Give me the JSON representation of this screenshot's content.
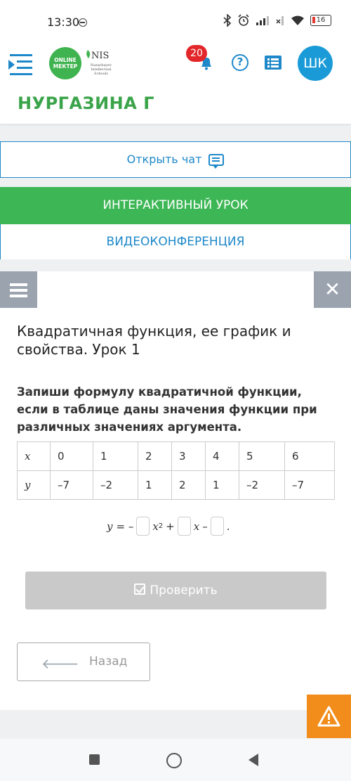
{
  "status_bar": {
    "time": "13:30",
    "battery": "16",
    "icons": [
      "bluetooth-icon",
      "alarm-icon",
      "signal-icon",
      "wifi-icon",
      "battery-icon"
    ]
  },
  "header": {
    "logo_onlinemektep": "ONLINE МЕКТЕР",
    "logo_nis": "NIS",
    "logo_nis_sub": "Nazarbayev Intellectual Schools",
    "notifications_count": "20",
    "avatar_initials": "ШК"
  },
  "user": {
    "name": "НУРГАЗИНА Г"
  },
  "buttons": {
    "open_chat": "Открыть чат",
    "interactive_lesson": "ИНТЕРАКТИВНЫЙ УРОК",
    "videoconference": "ВИДЕОКОНФЕРЕНЦИЯ",
    "check": "Проверить",
    "back": "Назад"
  },
  "lesson": {
    "title": "Квадратичная функция, ее график и свойства. Урок 1",
    "task": "Запиши формулу квадратичной функции, если в таблице даны значения функции при различных значениях аргумента."
  },
  "table": {
    "x_label": "x",
    "y_label": "y",
    "x_values": [
      "0",
      "1",
      "2",
      "3",
      "4",
      "5",
      "6"
    ],
    "y_values": [
      "–7",
      "–2",
      "1",
      "2",
      "1",
      "–2",
      "–7"
    ]
  },
  "formula": {
    "lhs": "y",
    "eq": "= –",
    "x2": "x",
    "exp": "2",
    "plus": "+",
    "x": "x",
    "minus": "–",
    "dot": "."
  },
  "colors": {
    "accent_blue": "#1e88c9",
    "green": "#3db756",
    "orange": "#f28c1a",
    "red_badge": "#e3262a"
  }
}
